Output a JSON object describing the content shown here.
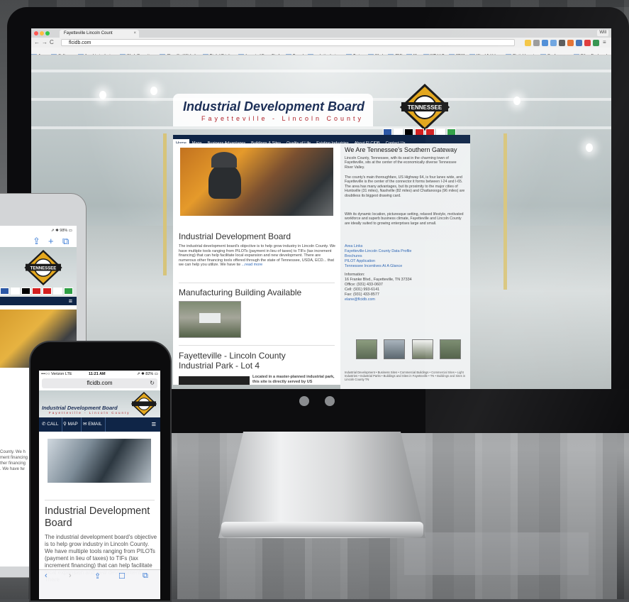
{
  "browser": {
    "tab_title": "Fayetteville Lincoln Count",
    "tab_close": "×",
    "user": "Will",
    "url": "flcidb.com",
    "bookmarks": [
      "Apps",
      "Software",
      "ilonal train desires",
      "Work Operations",
      "Classified Website",
      "Digital Printing",
      "Imported From Firefo",
      "Travel",
      "website designs",
      "Trains",
      "Work",
      "PMI",
      "Me",
      "WP LLC",
      "ICMA",
      "Word Ad Ideas",
      "Digital Inserts",
      "Conferences",
      "Other Bookmarks"
    ]
  },
  "site": {
    "title": "Industrial Development Board",
    "subtitle": "Fayetteville - Lincoln County",
    "nav": [
      "Home",
      "Maps",
      "Business Advantages",
      "Buildings & Sites",
      "Quality of Life",
      "Existing Industries",
      "About FLCIDB",
      "Contact Us"
    ],
    "badge_text": "TENNESSEE",
    "flag_colors": [
      "#2b57a5",
      "#ffffff",
      "#000000",
      "#d21f1f",
      "#d21f1f",
      "#ffffff",
      "#2e9e44"
    ],
    "main": {
      "heading1": "Industrial Development Board",
      "para1": "The industrial development board's objective is to help grow industry in Lincoln County. We have multiple tools ranging from PILOTs (payment in lieu of taxes) to TIFs (tax increment financing) that can help facilitate local expansion and new development. There are numerous other financing tools offered through the state of Tennessee, USDA, ECD... that we can help you utilize. We have tw",
      "read_more": "...read more",
      "heading2": "Manufacturing Building Available",
      "heading3": "Fayetteville - Lincoln County Industrial Park - Lot 4",
      "lot_text": "Located in a master-planned industrial park, this site is directly served by US"
    },
    "side": {
      "title": "We Are Tennessee's Southern Gateway",
      "p1": "Lincoln County, Tennessee, with its seat in the charming town of Fayetteville, sits at the center of the economically diverse Tennessee River Valley.",
      "p2": "The county's main thoroughfare, US Highway 64, is four lanes wide, and Fayetteville is the center of the connector it forms between I-24 and I-65. The area has many advantages, but its proximity to the major cities of Huntsville (31 miles), Nashville (82 miles) and Chattanooga (96 miles) are doubtless its biggest drawing card.",
      "p3": "With its dynamic location, picturesque setting, relaxed lifestyle, motivated workforce and superb business climate, Fayetteville and Lincoln County are ideally suited to growing enterprises large and small.",
      "links": [
        "Area Links",
        "Fayetteville-Lincoln County Data Profile",
        "Brochures",
        "PILOT Application",
        "Tennessee Incentives At A Glance"
      ],
      "info_label": "Information:",
      "address": "16 Franke Blvd., Fayetteville, TN 37334",
      "office": "Office: (931) 433-0607",
      "cell": "Cell: (931) 993-6141",
      "fax": "Fax: (931) 433-8577",
      "email": "elane@flcidb.com",
      "footer": "Industrial Development • Business Sites • Commercial Buildings • Commercial Sites • Light Industries • Industrial Parks • Buildings and Sites in Fayetteville • TN • Buildings and Sites in Lincoln County TN"
    }
  },
  "tablet": {
    "status": "⇗ ✱ 98% ▭",
    "menu_icon": "≡",
    "text_lines": [
      "County. We h",
      "ment financing",
      "ther financing",
      ". We have tw"
    ]
  },
  "phone": {
    "carrier": "•••○○ Verizon  LTE",
    "time": "11:21 AM",
    "battery": "⇗ ✱ 82% ▭",
    "url": "flcidb.com",
    "reload": "↻",
    "title": "Industrial Development Board",
    "subtitle": "Fayetteville - Lincoln County",
    "call": "CALL",
    "map": "MAP",
    "email": "EMAIL",
    "menu_icon": "≡",
    "heading": "Industrial Development Board",
    "para": "The industrial development board's objective is to help grow industry in Lincoln County. We have multiple tools ranging from PILOTs (payment in lieu of taxes) to TIFs (tax increment financing) that can help facilitate local expansion and new development. There"
  }
}
